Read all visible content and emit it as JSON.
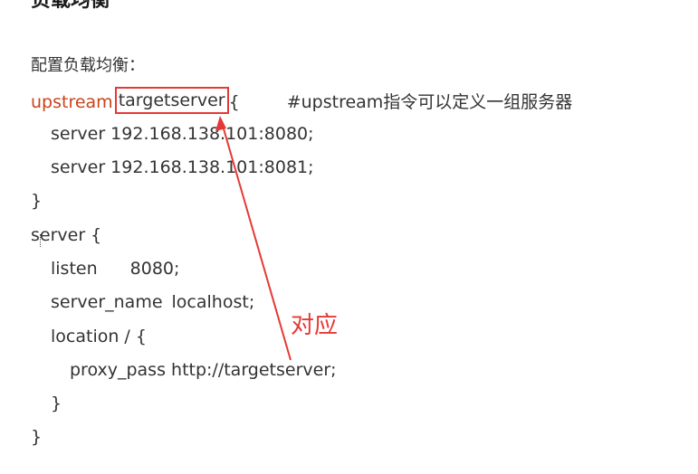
{
  "heading": "负载均衡",
  "intro": "配置负载均衡：",
  "code": {
    "upstream_keyword": "upstream",
    "upstream_name": "targetserver",
    "upstream_open": "{",
    "upstream_comment": "#upstream指令可以定义一组服务器",
    "server_line_1": "server 192.168.138.101:8080;",
    "server_line_2": "server 192.168.138.101:8081;",
    "close_upstream": "}",
    "server_block_open": "server {",
    "listen_key": "listen",
    "listen_value": "8080;",
    "server_name_key": "server_name",
    "server_name_value": "localhost;",
    "location_open": "location / {",
    "proxy_pass": "proxy_pass http://targetserver;",
    "location_close": "}",
    "server_block_close": "}"
  },
  "annotation": {
    "label": "对应",
    "color": "#e53935"
  },
  "colors": {
    "keyword": "#c8441a",
    "highlight_box": "#e53935",
    "text": "#333333"
  }
}
